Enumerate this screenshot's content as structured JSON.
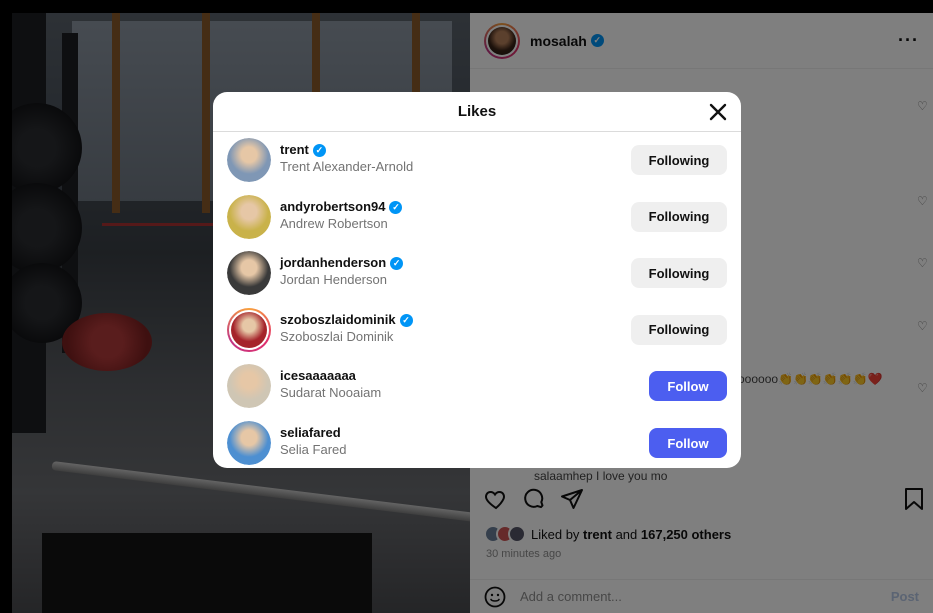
{
  "post": {
    "username": "mosalah",
    "verified_mark": "✓",
    "more_icon": "more-horizontal-icon",
    "comment_fragment": "oooooo👏👏👏👏👏👏❤️",
    "comment_clip": "salaamhep I love you mo",
    "likes": {
      "prefix": "Liked by",
      "user": "trent",
      "joiner": "and",
      "count": "167,250 others"
    },
    "timestamp": "30 minutes ago",
    "comment_placeholder": "Add a comment...",
    "post_label": "Post"
  },
  "likes_modal": {
    "title": "Likes",
    "close_icon": "close-icon",
    "users": [
      {
        "username": "trent",
        "full_name": "Trent Alexander-Arnold",
        "verified": true,
        "button": "Following",
        "state": "following",
        "story": false,
        "avatar_color": "#7f97b5"
      },
      {
        "username": "andyrobertson94",
        "full_name": "Andrew Robertson",
        "verified": true,
        "button": "Following",
        "state": "following",
        "story": false,
        "avatar_color": "#c9b24a"
      },
      {
        "username": "jordanhenderson",
        "full_name": "Jordan Henderson",
        "verified": true,
        "button": "Following",
        "state": "following",
        "story": false,
        "avatar_color": "#3a3a3a"
      },
      {
        "username": "szoboszlaidominik",
        "full_name": "Szoboszlai Dominik",
        "verified": true,
        "button": "Following",
        "state": "following",
        "story": true,
        "avatar_color": "#a5242b"
      },
      {
        "username": "icesaaaaaaa",
        "full_name": "Sudarat Nooaiam",
        "verified": false,
        "button": "Follow",
        "state": "follow",
        "story": false,
        "avatar_color": "#cfc6b4"
      },
      {
        "username": "seliafared",
        "full_name": "Selia Fared",
        "verified": false,
        "button": "Follow",
        "state": "follow",
        "story": false,
        "avatar_color": "#4d8fd1"
      }
    ]
  },
  "colors": {
    "follow_button": "#4c5ef0",
    "following_button": "#efefef",
    "verified_badge": "#0095f6"
  }
}
